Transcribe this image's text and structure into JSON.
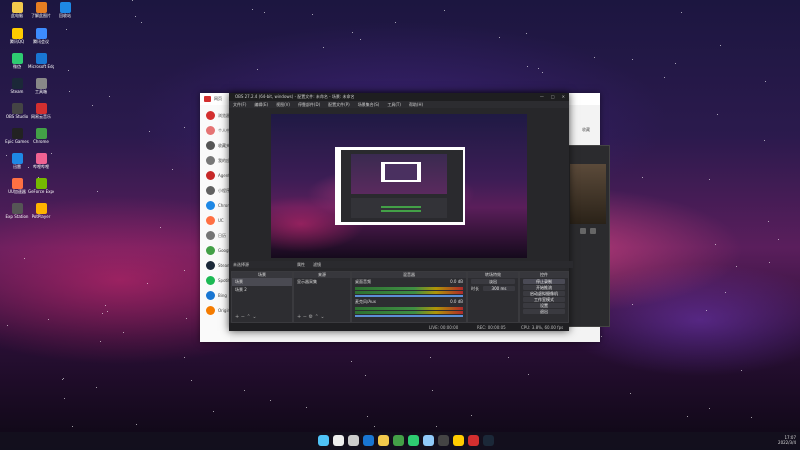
{
  "desktop": {
    "icons": [
      {
        "label": "此电脑",
        "color": "#f2c94c"
      },
      {
        "label": "了解此图片",
        "color": "#e67e22"
      },
      {
        "label": "回收站",
        "color": "#1e88e5"
      },
      {
        "label": "腾讯QQ",
        "color": "#ffcc00"
      },
      {
        "label": "腾讯会议",
        "color": "#3d8bfd"
      },
      {
        "label": "微信",
        "color": "#2ecc71"
      },
      {
        "label": "Microsoft Edge",
        "color": "#1976d2"
      },
      {
        "label": "Steam",
        "color": "#1b2838"
      },
      {
        "label": "工具箱",
        "color": "#888888"
      },
      {
        "label": "OBS Studio",
        "color": "#444444"
      },
      {
        "label": "网易云音乐",
        "color": "#d32f2f"
      },
      {
        "label": "Epic Games",
        "color": "#222222"
      },
      {
        "label": "Chrome",
        "color": "#43a047"
      },
      {
        "label": "迅雷",
        "color": "#1e88e5"
      },
      {
        "label": "哔哩哔哩",
        "color": "#f06292"
      },
      {
        "label": "UU加速器",
        "color": "#ff7043"
      },
      {
        "label": "GeForce Experience",
        "color": "#76b900"
      },
      {
        "label": "Exp Station",
        "color": "#555555"
      },
      {
        "label": "PotPlayer",
        "color": "#ffb300"
      }
    ]
  },
  "taskbar": {
    "icon_names": [
      "windows-icon",
      "search-icon",
      "taskview-icon",
      "edge-icon",
      "explorer-icon",
      "chrome-icon",
      "wechat-icon",
      "store-icon",
      "obs-icon",
      "qq-icon",
      "music-icon",
      "steam-icon"
    ],
    "time": "17:07",
    "date": "2022/3/4"
  },
  "browser": {
    "title": "网页",
    "sidebar_items": [
      {
        "label": "浏览器",
        "color": "#d32f2f"
      },
      {
        "label": "个人中心",
        "color": "#e57373"
      },
      {
        "label": "收藏夹",
        "color": "#555"
      },
      {
        "label": "我的应用",
        "color": "#777"
      },
      {
        "label": "Agent",
        "color": "#c62828"
      },
      {
        "label": "小程序",
        "color": "#616161"
      },
      {
        "label": "Chrome",
        "color": "#1e88e5"
      },
      {
        "label": "UC",
        "color": "#ff7043"
      },
      {
        "label": "日历",
        "color": "#757575"
      },
      {
        "label": "Google",
        "color": "#43a047"
      },
      {
        "label": "Steam",
        "color": "#1b2838"
      },
      {
        "label": "Spotify",
        "color": "#1db954"
      },
      {
        "label": "Bing",
        "color": "#1976d2"
      },
      {
        "label": "Origin",
        "color": "#f57c00"
      }
    ],
    "right_link": "收藏"
  },
  "obs": {
    "title": "OBS 27.2.4 (64-bit, windows) - 配置文件: 未命名 - 场景: 未命名",
    "menu": [
      "文件(F)",
      "编辑(E)",
      "视图(V)",
      "停靠部件(D)",
      "配置文件(P)",
      "场景集合(S)",
      "工具(T)",
      "帮助(H)"
    ],
    "status_line": "未选择源",
    "props_label": "属性",
    "filters_label": "滤镜",
    "docks": {
      "scenes": {
        "title": "场景",
        "items": [
          "场景",
          "场景 2"
        ]
      },
      "sources": {
        "title": "来源",
        "items": [
          "显示器采集"
        ]
      },
      "mixer": {
        "title": "混音器",
        "channels": [
          {
            "name": "桌面音频",
            "db": "0.0 dB"
          },
          {
            "name": "麦克风/Aux",
            "db": "0.0 dB"
          }
        ]
      },
      "transitions": {
        "title": "转场特效",
        "type": "淡出",
        "duration_label": "时长",
        "duration": "300 ms"
      },
      "controls": {
        "title": "控件",
        "buttons": [
          "停止录制",
          "开始推流",
          "启动虚拟摄像机",
          "工作室模式",
          "设置",
          "退出"
        ]
      }
    },
    "statusbar": {
      "live": "LIVE: 00:00:00",
      "rec": "REC: 00:00:05",
      "cpu": "CPU: 3.8%, 60.00 fps"
    }
  },
  "colors": {
    "accent": "#d32f2f",
    "obs_bg": "#27272a"
  }
}
